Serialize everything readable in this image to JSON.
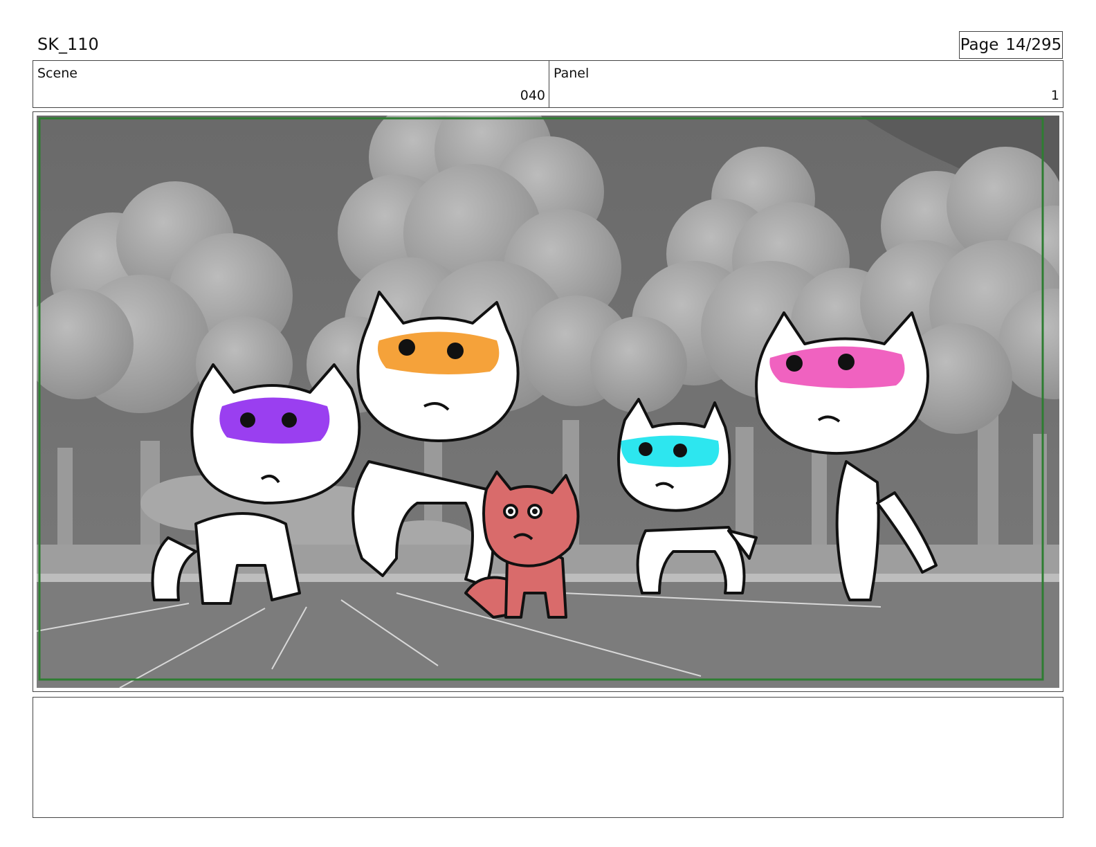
{
  "header": {
    "title": "SK_110",
    "page_label": "Page",
    "page_number": "14/295"
  },
  "scene": {
    "label": "Scene",
    "value": "040"
  },
  "panel": {
    "label": "Panel",
    "value": "1"
  },
  "artwork": {
    "characters": [
      {
        "id": "cat-purple-mask",
        "mask_color": "#9a3ff0"
      },
      {
        "id": "cat-orange-mask",
        "mask_color": "#f5a23a"
      },
      {
        "id": "cat-red-small",
        "body_color": "#d96b6b"
      },
      {
        "id": "cat-cyan-mask",
        "mask_color": "#2de6ef"
      },
      {
        "id": "cat-pink-mask",
        "mask_color": "#f062c0"
      }
    ],
    "safe_frame_color": "#2e7d32"
  },
  "notes": {
    "text": ""
  }
}
